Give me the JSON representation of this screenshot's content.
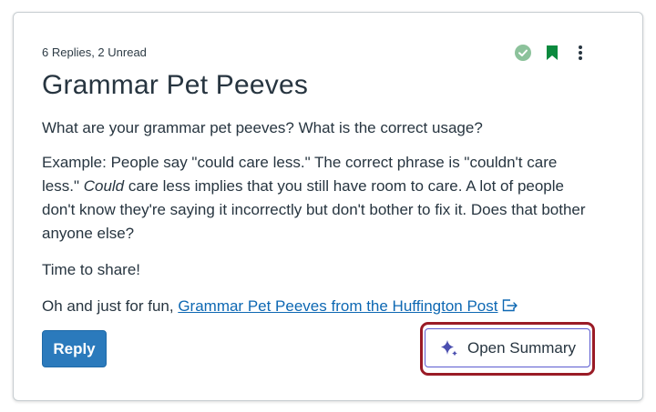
{
  "post": {
    "meta": "6 Replies, 2 Unread",
    "title": "Grammar Pet Peeves",
    "question": "What are your grammar pet peeves? What is the correct usage?",
    "example_part1": "Example: People say \"could care less.\" The correct phrase is \"couldn't care less.\" ",
    "example_italic": "Could",
    "example_part2": " care less implies that you still have room to care. A lot of people don't know they're saying it incorrectly but don't bother to fix it. Does that bother anyone else?",
    "share": "Time to share!",
    "fun_prefix": "Oh and just for fun, ",
    "link_text": "Grammar Pet Peeves from the Huffington Post"
  },
  "actions": {
    "reply_label": "Reply",
    "summary_label": "Open Summary"
  },
  "icons": {
    "check": "check-circle-icon",
    "bookmark": "bookmark-icon",
    "kebab": "kebab-menu-icon",
    "external": "external-link-icon",
    "sparkle": "sparkle-icon"
  },
  "colors": {
    "reply_button": "#2b7abc",
    "link": "#0e68b3",
    "bookmark": "#0b8a3e",
    "check": "#8cc29b",
    "highlight_outline": "#9a1b26",
    "summary_border": "#5a5ad0",
    "sparkle": "#4b4fb0"
  }
}
